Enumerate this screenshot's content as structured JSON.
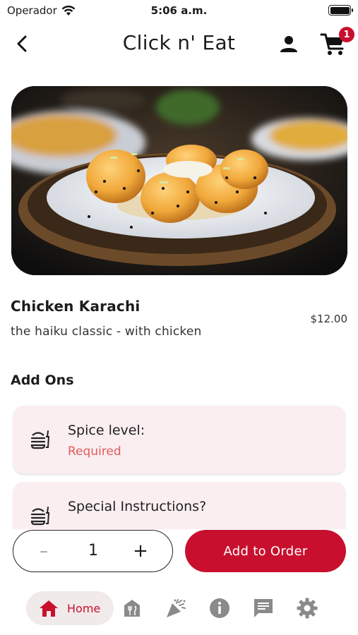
{
  "status_bar": {
    "carrier": "Operador",
    "time": "5:06 a.m."
  },
  "app_bar": {
    "title": "Click n' Eat",
    "cart_count": "1",
    "icons": [
      "back-icon",
      "user-icon",
      "cart-icon"
    ]
  },
  "item": {
    "name": "Chicken Karachi",
    "description": "the haiku classic - with chicken",
    "price": "$12.00"
  },
  "addons": {
    "heading": "Add Ons",
    "options": [
      {
        "title": "Spice level:",
        "subtitle": "Required",
        "icon": "burger-icon"
      },
      {
        "title": "Special Instructions?",
        "subtitle": "",
        "icon": "burger-icon"
      }
    ]
  },
  "order": {
    "quantity": "1",
    "minus_label": "–",
    "plus_label": "+",
    "add_label": "Add to Order"
  },
  "bottom_nav": {
    "items": [
      {
        "label": "Home",
        "icon": "home-icon",
        "active": true
      },
      {
        "label": "",
        "icon": "restaurant-icon"
      },
      {
        "label": "",
        "icon": "party-popper-icon"
      },
      {
        "label": "",
        "icon": "info-icon"
      },
      {
        "label": "",
        "icon": "chat-icon"
      },
      {
        "label": "",
        "icon": "settings-icon"
      }
    ]
  },
  "colors": {
    "accent": "#c8102e",
    "card_background": "#faeef0",
    "required_text": "#e35a5a",
    "nav_icon": "#888888"
  }
}
